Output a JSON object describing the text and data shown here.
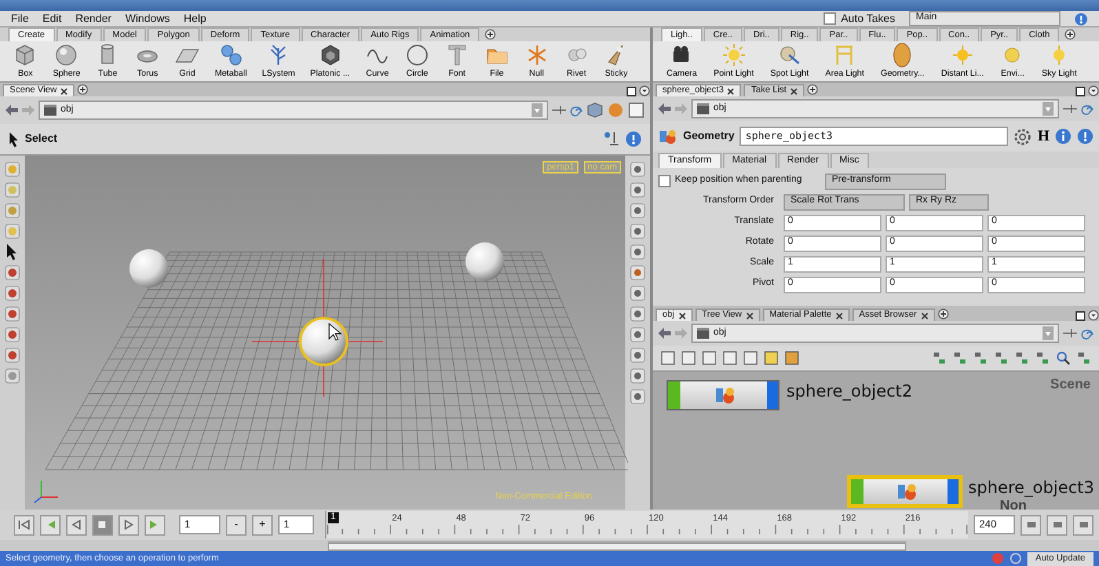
{
  "menu": [
    {
      "label": "File"
    },
    {
      "label": "Edit"
    },
    {
      "label": "Render"
    },
    {
      "label": "Windows"
    },
    {
      "label": "Help"
    }
  ],
  "auto_takes": {
    "label": "Auto Takes",
    "checked": false
  },
  "desktop": {
    "value": "Main"
  },
  "shelf_left": {
    "tabs": [
      {
        "label": "Create",
        "selected": true
      },
      {
        "label": "Modify",
        "selected": false
      },
      {
        "label": "Model",
        "selected": false
      },
      {
        "label": "Polygon",
        "selected": false
      },
      {
        "label": "Deform",
        "selected": false
      },
      {
        "label": "Texture",
        "selected": false
      },
      {
        "label": "Character",
        "selected": false
      },
      {
        "label": "Auto Rigs",
        "selected": false
      },
      {
        "label": "Animation",
        "selected": false
      }
    ],
    "tools": [
      {
        "label": "Box"
      },
      {
        "label": "Sphere"
      },
      {
        "label": "Tube"
      },
      {
        "label": "Torus"
      },
      {
        "label": "Grid"
      },
      {
        "label": "Metaball"
      },
      {
        "label": "LSystem"
      },
      {
        "label": "Platonic ..."
      },
      {
        "label": "Curve"
      },
      {
        "label": "Circle"
      },
      {
        "label": "Font"
      },
      {
        "label": "File"
      },
      {
        "label": "Null"
      },
      {
        "label": "Rivet"
      },
      {
        "label": "Sticky"
      }
    ]
  },
  "shelf_right": {
    "tabs": [
      {
        "label": "Ligh..",
        "selected": true
      },
      {
        "label": "Cre..",
        "selected": false
      },
      {
        "label": "Dri..",
        "selected": false
      },
      {
        "label": "Rig..",
        "selected": false
      },
      {
        "label": "Par..",
        "selected": false
      },
      {
        "label": "Flu..",
        "selected": false
      },
      {
        "label": "Pop..",
        "selected": false
      },
      {
        "label": "Con..",
        "selected": false
      },
      {
        "label": "Pyr..",
        "selected": false
      },
      {
        "label": "Cloth",
        "selected": false
      }
    ],
    "tools": [
      {
        "label": "Camera"
      },
      {
        "label": "Point Light"
      },
      {
        "label": "Spot Light"
      },
      {
        "label": "Area Light"
      },
      {
        "label": "Geometry..."
      },
      {
        "label": "Distant Li..."
      },
      {
        "label": "Envi..."
      },
      {
        "label": "Sky Light"
      }
    ]
  },
  "scene_view": {
    "tab": "Scene View",
    "path": "obj",
    "tool": "Select",
    "camera": "persp1",
    "cam_menu": "no cam",
    "edition": "Non-Commercial Edition",
    "spheres": [
      {
        "selected": false
      },
      {
        "selected": false
      },
      {
        "selected": true
      }
    ]
  },
  "parameters": {
    "tabs": [
      {
        "label": "sphere_object3",
        "selected": true
      },
      {
        "label": "Take List",
        "selected": false
      }
    ],
    "path": "obj",
    "node_type": "Geometry",
    "node_name": "sphere_object3",
    "hda_menu": "H",
    "param_tabs": [
      {
        "label": "Transform",
        "selected": true
      },
      {
        "label": "Material",
        "selected": false
      },
      {
        "label": "Render",
        "selected": false
      },
      {
        "label": "Misc",
        "selected": false
      }
    ],
    "keep_position": {
      "label": "Keep position when parenting",
      "checked": false
    },
    "pre_transform": "Pre-transform",
    "transform_order": {
      "label": "Transform Order",
      "value": "Scale Rot Trans",
      "rot_order": "Rx Ry Rz"
    },
    "rows": [
      {
        "label": "Translate",
        "values": [
          "0",
          "0",
          "0"
        ]
      },
      {
        "label": "Rotate",
        "values": [
          "0",
          "0",
          "0"
        ]
      },
      {
        "label": "Scale",
        "values": [
          "1",
          "1",
          "1"
        ]
      },
      {
        "label": "Pivot",
        "values": [
          "0",
          "0",
          "0"
        ]
      }
    ]
  },
  "network": {
    "tabs": [
      {
        "label": "obj",
        "selected": true
      },
      {
        "label": "Tree View",
        "selected": false
      },
      {
        "label": "Material Palette",
        "selected": false
      },
      {
        "label": "Asset Browser",
        "selected": false
      }
    ],
    "path": "obj",
    "context": "Scene",
    "edition": "Non",
    "nodes": [
      {
        "name": "sphere_object2",
        "selected": false
      },
      {
        "name": "sphere_object3",
        "selected": true
      }
    ]
  },
  "playbar": {
    "transport": [
      {
        "selected": false
      },
      {
        "selected": false
      },
      {
        "selected": false
      },
      {
        "selected": true
      },
      {
        "selected": false
      },
      {
        "selected": false
      }
    ],
    "frame": "1",
    "minus": "-",
    "plus": "+",
    "step": "1",
    "start_marker": "1",
    "ticks": [
      "24",
      "48",
      "72",
      "96",
      "120",
      "144",
      "168",
      "192",
      "216"
    ],
    "end": "240",
    "range": {
      "level": 1
    }
  },
  "status": {
    "message": "Select geometry, then choose an operation to perform",
    "update_mode": "Auto Update"
  }
}
